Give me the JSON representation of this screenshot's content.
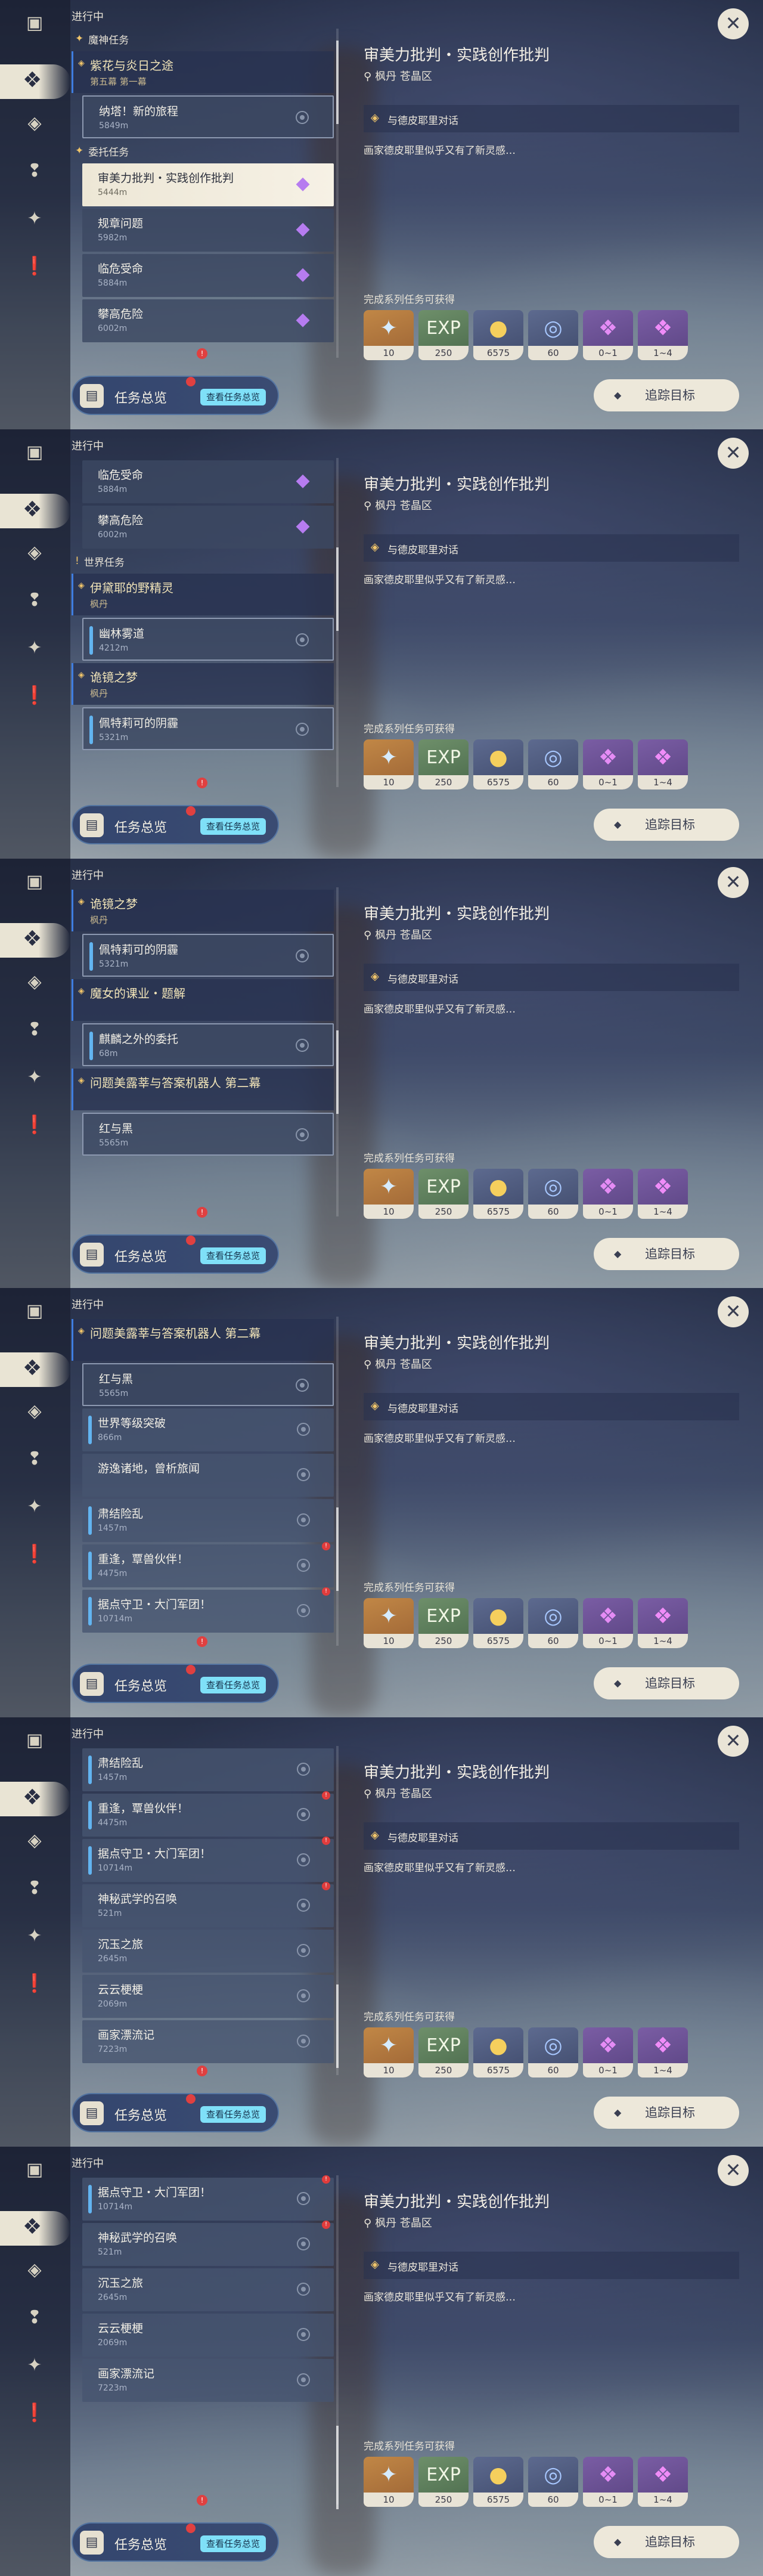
{
  "rail": {
    "icons": [
      "quest-book-icon",
      "archon-quest-icon",
      "story-quest-icon",
      "world-quest-icon",
      "event-icon",
      "notice-icon"
    ]
  },
  "status_label": "进行中",
  "overview": {
    "label": "任务总览",
    "sub": "查看任务总览"
  },
  "detail": {
    "title": "审美力批判・实践创作批判",
    "location": "枫丹 苍晶区",
    "objective": "与德皮耶里对话",
    "description": "画家德皮耶里似乎又有了新灵感…",
    "rewards_label": "完成系列任务可获得",
    "rewards": [
      {
        "name": "primogem",
        "qty": "10"
      },
      {
        "name": "adventure-exp",
        "qty": "250"
      },
      {
        "name": "mora",
        "qty": "6575"
      },
      {
        "name": "companionship-exp",
        "qty": "60"
      },
      {
        "name": "crystal-small",
        "qty": "0~1"
      },
      {
        "name": "crystal-large",
        "qty": "1~4"
      }
    ],
    "track_label": "追踪目标"
  },
  "quests": {
    "archon_section": "魔神任务",
    "archon_title": "紫花与炎日之途",
    "archon_sub": "第五幕 第一幕",
    "archon_item": "纳塔！新的旅程",
    "archon_item_dist": "5849m",
    "commission_section": "委托任务",
    "c1": "审美力批判・实践创作批判",
    "c1d": "5444m",
    "c2": "规章问题",
    "c2d": "5982m",
    "c3": "临危受命",
    "c3d": "5884m",
    "c4": "攀高危险",
    "c4d": "6002m",
    "world_section": "世界任务",
    "w1": "伊黛耶的野精灵",
    "w1r": "枫丹",
    "w1i": "幽林雾道",
    "w1id": "4212m",
    "w2": "诡镜之梦",
    "w2r": "枫丹",
    "w2i": "佩特莉可的阴霾",
    "w2id": "5321m",
    "w3": "魔女的课业・题解",
    "w3i": "麒麟之外的委托",
    "w3id": "68m",
    "w4": "问题美露莘与答案机器人 第二幕",
    "w4i": "红与黑",
    "w4id": "5565m",
    "e1": "世界等级突破",
    "e1d": "866m",
    "e2": "游逸诸地，曾析旅闻",
    "e3": "肃结险乱",
    "e3d": "1457m",
    "e4": "重逢，覃兽伙伴！",
    "e4d": "4475m",
    "e5": "据点守卫・大门军团！",
    "e5d": "10714m",
    "e6": "神秘武学的召唤",
    "e6d": "521m",
    "e7": "沉玉之旅",
    "e7d": "2645m",
    "e8": "云云梗梗",
    "e8d": "2069m",
    "e9": "画家漂流记",
    "e9d": "7223m"
  }
}
